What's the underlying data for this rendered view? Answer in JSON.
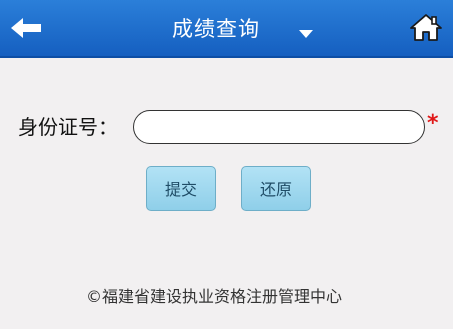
{
  "header": {
    "title": "成绩查询",
    "back_icon": "back-arrow-icon",
    "dropdown_icon": "chevron-down-icon",
    "home_icon": "home-icon",
    "colors": {
      "bar_top": "#2b7fd9",
      "bar_bottom": "#155fc0",
      "text": "#ffffff"
    }
  },
  "form": {
    "id_label": "身份证号：",
    "id_value": "",
    "id_placeholder": "",
    "required_mark": "*",
    "required_color": "#e01818"
  },
  "buttons": {
    "submit_label": "提交",
    "reset_label": "还原"
  },
  "footer": {
    "text": "©福建省建设执业资格注册管理中心"
  }
}
